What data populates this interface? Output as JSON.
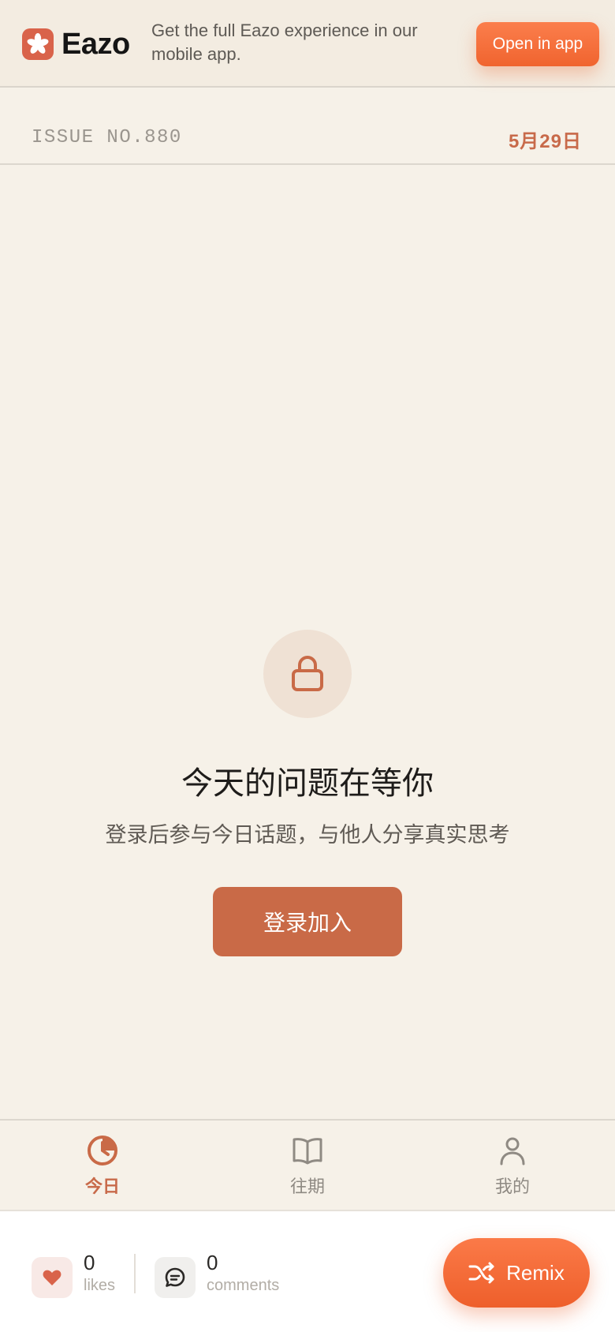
{
  "banner": {
    "brand_name": "Eazo",
    "promo_text": "Get the full Eazo experience in our mobile app.",
    "open_button": "Open in app"
  },
  "issue": {
    "number": "ISSUE NO.880",
    "date": "5月29日"
  },
  "locked": {
    "title": "今天的问题在等你",
    "subtitle": "登录后参与今日话题，与他人分享真实思考",
    "login_button": "登录加入"
  },
  "tabs": [
    {
      "label": "今日",
      "icon": "clock-icon",
      "active": true
    },
    {
      "label": "往期",
      "icon": "book-icon",
      "active": false
    },
    {
      "label": "我的",
      "icon": "user-icon",
      "active": false
    }
  ],
  "footer": {
    "likes_count": "0",
    "likes_label": "likes",
    "comments_count": "0",
    "comments_label": "comments",
    "remix_label": "Remix"
  },
  "colors": {
    "accent": "#c96a47",
    "cta_orange": "#f26a35",
    "background": "#f6f1e8"
  }
}
